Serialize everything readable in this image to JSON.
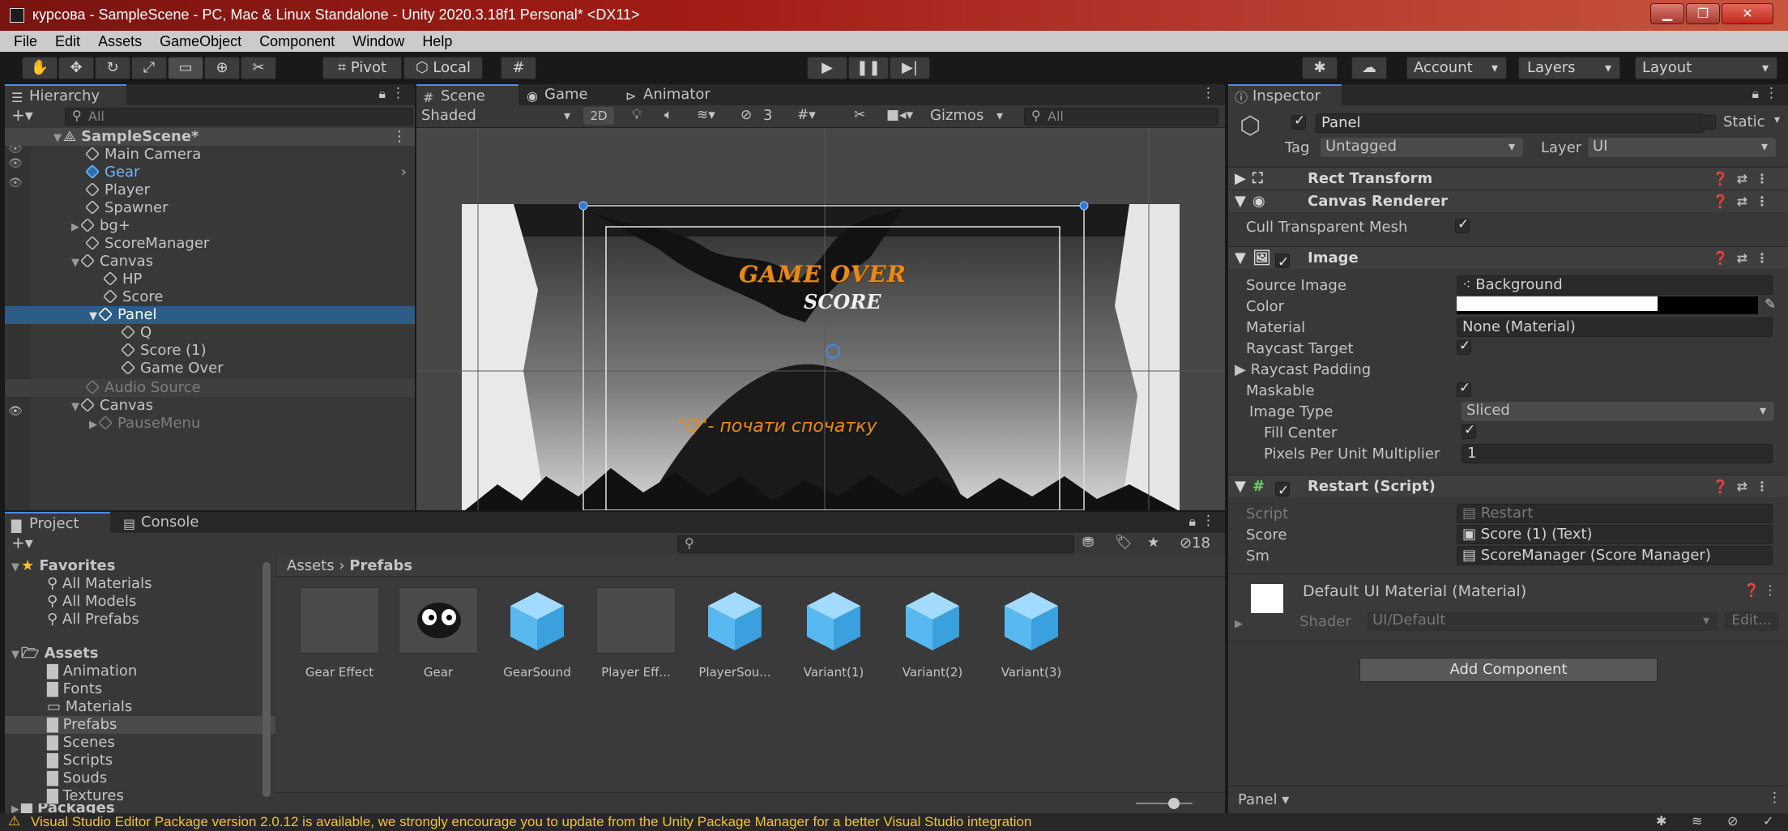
{
  "window": {
    "title": "курсова - SampleScene - PC, Mac & Linux Standalone - Unity 2020.3.18f1 Personal* <DX11>",
    "minimize": "▁",
    "maximize": "❐",
    "close": "✕"
  },
  "menu": [
    "File",
    "Edit",
    "Assets",
    "GameObject",
    "Component",
    "Window",
    "Help"
  ],
  "toolbar": {
    "pivot": "Pivot",
    "local": "Local",
    "account": "Account",
    "layers": "Layers",
    "layout": "Layout"
  },
  "hierarchy": {
    "tab": "Hierarchy",
    "search_placeholder": "All",
    "scene": "SampleScene*",
    "items": [
      {
        "label": "Main Camera"
      },
      {
        "label": "Gear"
      },
      {
        "label": "Player"
      },
      {
        "label": "Spawner"
      },
      {
        "label": "bg+"
      },
      {
        "label": "ScoreManager"
      },
      {
        "label": "Canvas"
      },
      {
        "label": "HP"
      },
      {
        "label": "Score"
      },
      {
        "label": "Panel"
      },
      {
        "label": "Q"
      },
      {
        "label": "Score (1)"
      },
      {
        "label": "Game Over"
      },
      {
        "label": "Audio Source"
      },
      {
        "label": "Canvas"
      },
      {
        "label": "PauseMenu"
      }
    ]
  },
  "scene_view": {
    "tabs": [
      "Scene",
      "Game",
      "Animator"
    ],
    "shading": "Shaded",
    "mode_2d": "2D",
    "hidden_count": "3",
    "gizmos": "Gizmos",
    "search_placeholder": "All",
    "game_over_text": "GAME OVER",
    "score_text": "SCORE",
    "restart_hint": "\"Q\"- почати спочатку"
  },
  "inspector": {
    "tab": "Inspector",
    "object_name": "Panel",
    "static_label": "Static",
    "tag_label": "Tag",
    "tag_value": "Untagged",
    "layer_label": "Layer",
    "layer_value": "UI",
    "components": {
      "rect_transform": "Rect Transform",
      "canvas_renderer": "Canvas Renderer",
      "cull_transparent_mesh": "Cull Transparent Mesh",
      "image": "Image",
      "restart_script": "Restart (Script)"
    },
    "image_props": {
      "source_image_label": "Source Image",
      "source_image_value": "Background",
      "color_label": "Color",
      "material_label": "Material",
      "material_value": "None (Material)",
      "raycast_target_label": "Raycast Target",
      "raycast_padding_label": "Raycast Padding",
      "maskable_label": "Maskable",
      "image_type_label": "Image Type",
      "image_type_value": "Sliced",
      "fill_center_label": "Fill Center",
      "ppu_label": "Pixels Per Unit Multiplier",
      "ppu_value": "1"
    },
    "script_props": {
      "script_label": "Script",
      "script_value": "Restart",
      "score_label": "Score",
      "score_value": "Score (1) (Text)",
      "sm_label": "Sm",
      "sm_value": "ScoreManager (Score Manager)"
    },
    "material": {
      "name": "Default UI Material (Material)",
      "shader_label": "Shader",
      "shader_value": "UI/Default",
      "edit_label": "Edit..."
    },
    "add_component": "Add Component",
    "footer_label": "Panel"
  },
  "project": {
    "tabs": [
      "Project",
      "Console"
    ],
    "hidden_count": "18",
    "favorites": {
      "label": "Favorites",
      "items": [
        "All Materials",
        "All Models",
        "All Prefabs"
      ]
    },
    "assets": {
      "label": "Assets",
      "items": [
        "Animation",
        "Fonts",
        "Materials",
        "Prefabs",
        "Scenes",
        "Scripts",
        "Souds",
        "Textures"
      ]
    },
    "packages_label": "Packages",
    "breadcrumb_root": "Assets",
    "breadcrumb_sep": "›",
    "breadcrumb_current": "Prefabs",
    "prefab_items": [
      {
        "label": "Gear Effect",
        "icon": "gray-box"
      },
      {
        "label": "Gear",
        "icon": "gear-face"
      },
      {
        "label": "GearSound",
        "icon": "prefab-cube"
      },
      {
        "label": "Player Eff...",
        "icon": "gray-box"
      },
      {
        "label": "PlayerSou...",
        "icon": "prefab-cube"
      },
      {
        "label": "Variant(1)",
        "icon": "prefab-cube"
      },
      {
        "label": "Variant(2)",
        "icon": "prefab-cube"
      },
      {
        "label": "Variant(3)",
        "icon": "prefab-cube"
      }
    ]
  },
  "status_bar": {
    "message": "Visual Studio Editor Package version 2.0.12 is available, we strongly encourage you to update from the Unity Package Manager for a better Visual Studio integration"
  },
  "colors": {
    "accent_blue": "#4b8be8",
    "selection": "#2c5d87",
    "game_over_orange": "#e88a1a",
    "title_bar_red": "#a31d16"
  }
}
